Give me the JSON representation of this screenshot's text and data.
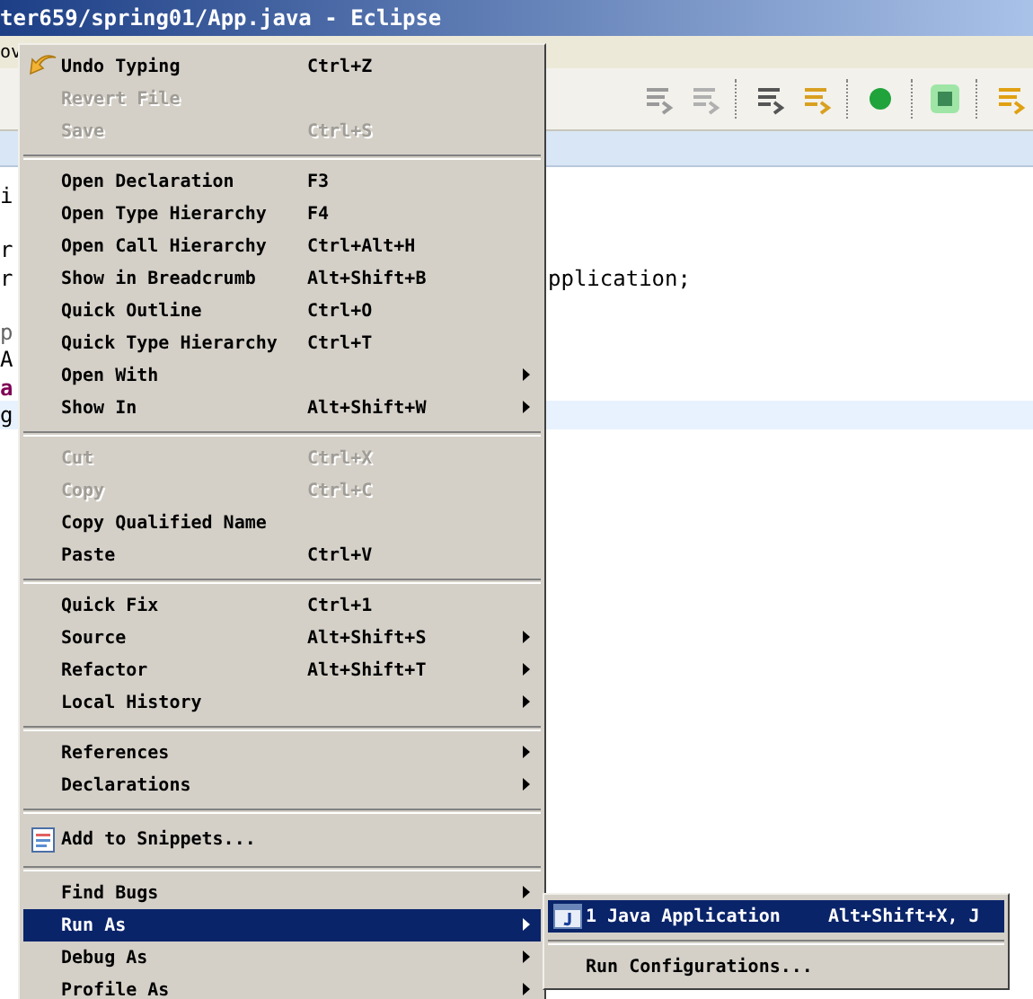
{
  "window": {
    "title": "ter659/spring01/App.java - Eclipse"
  },
  "menu_bar": [
    "ov"
  ],
  "editor": {
    "lines": [
      {
        "kind": "code",
        "left": "i",
        "current": false
      },
      {
        "kind": "blank",
        "current": false
      },
      {
        "kind": "code",
        "left": "r",
        "current": false
      },
      {
        "kind": "code",
        "left": "r",
        "right": "pplication;",
        "current": false
      },
      {
        "kind": "blank",
        "current": false
      },
      {
        "kind": "annotation",
        "left": "p",
        "current": false
      },
      {
        "kind": "code",
        "left": "A",
        "current": false
      },
      {
        "kind": "keyword",
        "left": "a",
        "current": false
      },
      {
        "kind": "code",
        "left": "g",
        "current": true
      }
    ]
  },
  "context_menu": [
    {
      "kind": "iconitem",
      "label": "Undo Typing",
      "shortcut": "Ctrl+Z",
      "disabled": false,
      "submenu": false,
      "selected": false
    },
    {
      "kind": "item",
      "label": "Revert File",
      "disabled": true,
      "submenu": false,
      "selected": false
    },
    {
      "kind": "item",
      "label": "Save",
      "shortcut": "Ctrl+S",
      "disabled": true,
      "submenu": false,
      "selected": false
    },
    {
      "kind": "separator"
    },
    {
      "kind": "item",
      "label": "Open Declaration",
      "shortcut": "F3",
      "disabled": false,
      "submenu": false,
      "selected": false
    },
    {
      "kind": "item",
      "label": "Open Type Hierarchy",
      "shortcut": "F4",
      "disabled": false,
      "submenu": false,
      "selected": false
    },
    {
      "kind": "item",
      "label": "Open Call Hierarchy",
      "shortcut": "Ctrl+Alt+H",
      "disabled": false,
      "submenu": false,
      "selected": false
    },
    {
      "kind": "item",
      "label": "Show in Breadcrumb",
      "shortcut": "Alt+Shift+B",
      "disabled": false,
      "submenu": false,
      "selected": false
    },
    {
      "kind": "item",
      "label": "Quick Outline",
      "shortcut": "Ctrl+O",
      "disabled": false,
      "submenu": false,
      "selected": false
    },
    {
      "kind": "item",
      "label": "Quick Type Hierarchy",
      "shortcut": "Ctrl+T",
      "disabled": false,
      "submenu": false,
      "selected": false
    },
    {
      "kind": "item",
      "label": "Open With",
      "disabled": false,
      "submenu": true,
      "selected": false
    },
    {
      "kind": "item",
      "label": "Show In",
      "shortcut": "Alt+Shift+W",
      "disabled": false,
      "submenu": true,
      "selected": false
    },
    {
      "kind": "separator"
    },
    {
      "kind": "item",
      "label": "Cut",
      "shortcut": "Ctrl+X",
      "disabled": true,
      "submenu": false,
      "selected": false
    },
    {
      "kind": "item",
      "label": "Copy",
      "shortcut": "Ctrl+C",
      "disabled": true,
      "submenu": false,
      "selected": false
    },
    {
      "kind": "item",
      "label": "Copy Qualified Name",
      "disabled": false,
      "submenu": false,
      "selected": false
    },
    {
      "kind": "item",
      "label": "Paste",
      "shortcut": "Ctrl+V",
      "disabled": false,
      "submenu": false,
      "selected": false
    },
    {
      "kind": "separator"
    },
    {
      "kind": "item",
      "label": "Quick Fix",
      "shortcut": "Ctrl+1",
      "disabled": false,
      "submenu": false,
      "selected": false
    },
    {
      "kind": "item",
      "label": "Source",
      "shortcut": "Alt+Shift+S",
      "disabled": false,
      "submenu": true,
      "selected": false
    },
    {
      "kind": "item",
      "label": "Refactor",
      "shortcut": "Alt+Shift+T",
      "disabled": false,
      "submenu": true,
      "selected": false
    },
    {
      "kind": "item",
      "label": "Local History",
      "disabled": false,
      "submenu": true,
      "selected": false
    },
    {
      "kind": "separator"
    },
    {
      "kind": "item",
      "label": "References",
      "disabled": false,
      "submenu": true,
      "selected": false
    },
    {
      "kind": "item",
      "label": "Declarations",
      "disabled": false,
      "submenu": true,
      "selected": false
    },
    {
      "kind": "separator"
    },
    {
      "kind": "iconitem",
      "label": "Add to Snippets...",
      "disabled": false,
      "submenu": false,
      "selected": false
    },
    {
      "kind": "separator"
    },
    {
      "kind": "item",
      "label": "Find Bugs",
      "disabled": false,
      "submenu": true,
      "selected": false
    },
    {
      "kind": "item",
      "label": "Run As",
      "disabled": false,
      "submenu": true,
      "selected": true
    },
    {
      "kind": "item",
      "label": "Debug As",
      "disabled": false,
      "submenu": true,
      "selected": false
    },
    {
      "kind": "item",
      "label": "Profile As",
      "disabled": false,
      "submenu": true,
      "selected": false
    }
  ],
  "submenu": [
    {
      "kind": "iconitem",
      "label": "1 Java Application",
      "shortcut": "Alt+Shift+X, J",
      "selected": true
    },
    {
      "kind": "separator"
    },
    {
      "kind": "item",
      "label": "Run Configurations...",
      "selected": false
    }
  ]
}
